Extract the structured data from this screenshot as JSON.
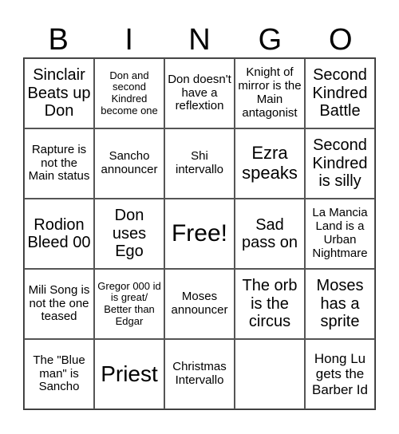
{
  "header": {
    "letters": [
      "B",
      "I",
      "N",
      "G",
      "O"
    ]
  },
  "cells": [
    "Sinclair Beats up Don",
    "Don and second Kindred become one",
    "Don doesn't have a reflextion",
    "Knight of mirror is the Main antagonist",
    "Second Kindred Battle",
    "Rapture is not the Main status",
    "Sancho announcer",
    "Shi intervallo",
    "Ezra speaks",
    "Second Kindred is silly",
    "Rodion Bleed 00",
    "Don uses Ego",
    "Free!",
    "Sad pass on",
    "La Mancia Land is a Urban Nightmare",
    "Mili Song is not the one teased",
    "Gregor 000 id is great/ Better than Edgar",
    "Moses announcer",
    "The orb is the circus",
    "Moses has a sprite",
    "The \"Blue man\" is Sancho",
    "Priest",
    "Christmas Intervallo",
    "",
    "Hong Lu gets the Barber Id"
  ]
}
